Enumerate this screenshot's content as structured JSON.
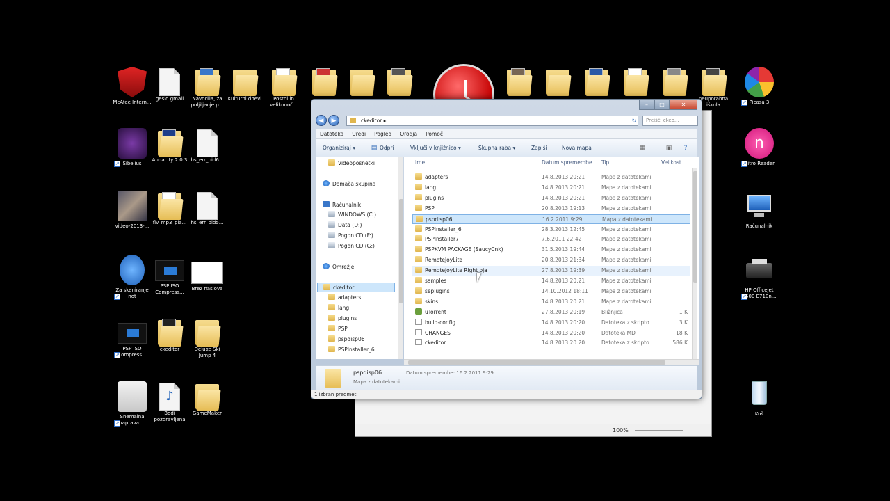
{
  "desktop": {
    "icons": [
      {
        "label": "McAfee Intern...",
        "kind": "mcafee-icon"
      },
      {
        "label": "geslo gmail",
        "kind": "file-icon"
      },
      {
        "label": "Navodila, za poljiljanje p...",
        "kind": "folder-icon"
      },
      {
        "label": "Kulturni dnevi",
        "kind": "folder-icon"
      },
      {
        "label": "Postni in velikonoč...",
        "kind": "folder-icon"
      },
      {
        "label": "Sibelius",
        "kind": "sibelius-icon"
      },
      {
        "label": "Audacity 2.0.3",
        "kind": "folder-icon"
      },
      {
        "label": "hs_err_pid6...",
        "kind": "file-icon"
      },
      {
        "label": "video-2013-...",
        "kind": "video-icon"
      },
      {
        "label": "flv_mp3_pla...",
        "kind": "folder-icon"
      },
      {
        "label": "hs_err_pid5...",
        "kind": "file-icon"
      },
      {
        "label": "Za skeniranje not",
        "kind": "scanner-icon"
      },
      {
        "label": "PSP ISO Compress...",
        "kind": "psp-icon"
      },
      {
        "label": "Brez naslova",
        "kind": "image-icon"
      },
      {
        "label": "PSP ISO Compress...",
        "kind": "psp-icon"
      },
      {
        "label": "ckeditor",
        "kind": "folder-icon"
      },
      {
        "label": "Deluxe Ski Jump 4",
        "kind": "folder-icon"
      },
      {
        "label": "Snemalna naprava ...",
        "kind": "recorder-icon"
      },
      {
        "label": "Bodi pozdravljena",
        "kind": "mp3-icon"
      },
      {
        "label": "GameMaker",
        "kind": "folder-icon"
      },
      {
        "label": "Picasa 3",
        "kind": "picasa-icon"
      },
      {
        "label": "Nitro Reader",
        "kind": "nitro-icon"
      },
      {
        "label": "Računalnik",
        "kind": "computer-icon"
      },
      {
        "label": "HP Officejet 6500 E710n...",
        "kind": "printer-icon"
      },
      {
        "label": "Koš",
        "kind": "recycle-bin-icon"
      },
      {
        "label": "neuporabna iškola",
        "kind": "folder-icon"
      }
    ]
  },
  "bgwindow": {
    "zoom": "100%"
  },
  "explorer": {
    "address": "ckeditor",
    "search_placeholder": "Preišči ckeo...",
    "menu": [
      "Datoteka",
      "Uredi",
      "Pogled",
      "Orodja",
      "Pomoč"
    ],
    "toolbar": {
      "organize": "Organiziraj ▾",
      "open": "Odpri",
      "include": "Vključi v knjižnico ▾",
      "share": "Skupna raba ▾",
      "burn": "Zapiši",
      "new_folder": "Nova mapa"
    },
    "tree": [
      {
        "label": "Videoposnetki",
        "kind": "folder"
      },
      {
        "label": "Domača skupina",
        "kind": "net"
      },
      {
        "label": "Računalnik",
        "kind": "pc"
      },
      {
        "label": "WINDOWS (C:)",
        "kind": "drive"
      },
      {
        "label": "Data (D:)",
        "kind": "drive"
      },
      {
        "label": "Pogon CD (F:)",
        "kind": "drive"
      },
      {
        "label": "Pogon CD (G:)",
        "kind": "drive"
      },
      {
        "label": "Omrežje",
        "kind": "net"
      },
      {
        "label": "ckeditor",
        "kind": "folder"
      },
      {
        "label": "adapters",
        "kind": "folder"
      },
      {
        "label": "lang",
        "kind": "folder"
      },
      {
        "label": "plugins",
        "kind": "folder"
      },
      {
        "label": "PSP",
        "kind": "folder"
      },
      {
        "label": "pspdisp06",
        "kind": "folder"
      },
      {
        "label": "PSPInstaller_6",
        "kind": "folder"
      }
    ],
    "columns": {
      "name": "Ime",
      "date": "Datum spremembe",
      "type": "Tip",
      "size": "Velikost"
    },
    "files": [
      {
        "name": "adapters",
        "date": "14.8.2013 20:21",
        "type": "Mapa z datotekami",
        "size": "",
        "kind": "folder"
      },
      {
        "name": "lang",
        "date": "14.8.2013 20:21",
        "type": "Mapa z datotekami",
        "size": "",
        "kind": "folder"
      },
      {
        "name": "plugins",
        "date": "14.8.2013 20:21",
        "type": "Mapa z datotekami",
        "size": "",
        "kind": "folder"
      },
      {
        "name": "PSP",
        "date": "20.8.2013 19:13",
        "type": "Mapa z datotekami",
        "size": "",
        "kind": "folder"
      },
      {
        "name": "pspdisp06",
        "date": "16.2.2011 9:29",
        "type": "Mapa z datotekami",
        "size": "",
        "kind": "folder"
      },
      {
        "name": "PSPInstaller_6",
        "date": "28.3.2013 12:45",
        "type": "Mapa z datotekami",
        "size": "",
        "kind": "folder"
      },
      {
        "name": "PSPInstaller7",
        "date": "7.6.2011 22:42",
        "type": "Mapa z datotekami",
        "size": "",
        "kind": "folder"
      },
      {
        "name": "PSPKVM PACKAGE (SaucyCnk)",
        "date": "31.5.2013 19:44",
        "type": "Mapa z datotekami",
        "size": "",
        "kind": "folder"
      },
      {
        "name": "RemoteJoyLite",
        "date": "20.8.2013 21:34",
        "type": "Mapa z datotekami",
        "size": "",
        "kind": "folder"
      },
      {
        "name": "RemoteJoyLite Right oja",
        "date": "27.8.2013 19:39",
        "type": "Mapa z datotekami",
        "size": "",
        "kind": "folder"
      },
      {
        "name": "samples",
        "date": "14.8.2013 20:21",
        "type": "Mapa z datotekami",
        "size": "",
        "kind": "folder"
      },
      {
        "name": "seplugins",
        "date": "14.10.2012 18:11",
        "type": "Mapa z datotekami",
        "size": "",
        "kind": "folder"
      },
      {
        "name": "skins",
        "date": "14.8.2013 20:21",
        "type": "Mapa z datotekami",
        "size": "",
        "kind": "folder"
      },
      {
        "name": "uTorrent",
        "date": "27.8.2013 20:19",
        "type": "Bližnjica",
        "size": "1 K",
        "kind": "app"
      },
      {
        "name": "build-config",
        "date": "14.8.2013 20:20",
        "type": "Datoteka z skripto...",
        "size": "3 K",
        "kind": "file"
      },
      {
        "name": "CHANGES",
        "date": "14.8.2013 20:20",
        "type": "Datoteka MD",
        "size": "18 K",
        "kind": "file"
      },
      {
        "name": "ckeditor",
        "date": "14.8.2013 20:20",
        "type": "Datoteka z skripto...",
        "size": "586 K",
        "kind": "file"
      }
    ],
    "details": {
      "name": "pspdisp06",
      "meta_label": "Datum spremembe: 16.2.2011 9:29",
      "kind": "Mapa z datotekami"
    },
    "status": "1 izbran predmet"
  }
}
